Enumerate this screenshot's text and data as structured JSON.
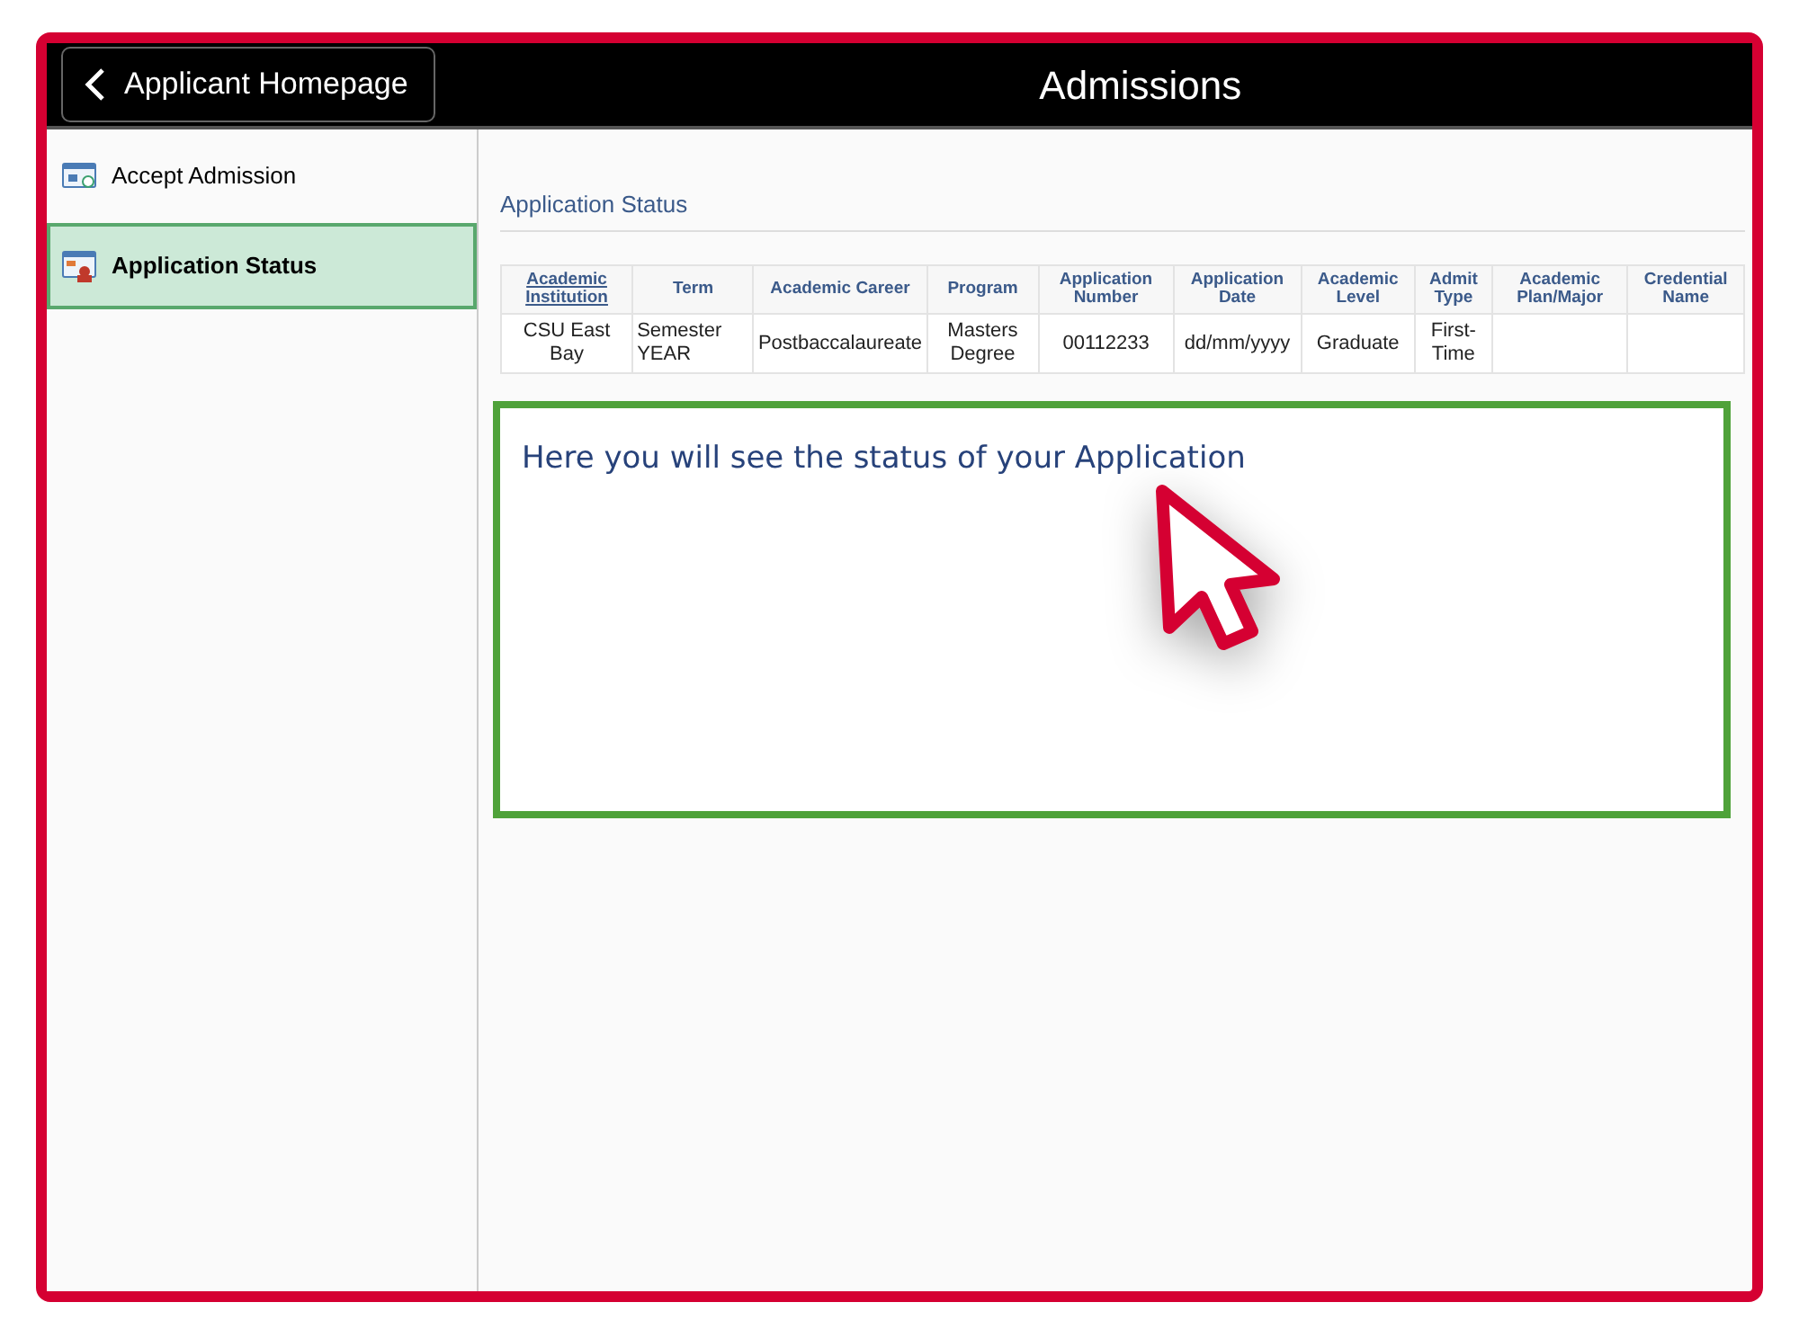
{
  "header": {
    "back_label": "Applicant Homepage",
    "title": "Admissions"
  },
  "sidebar": {
    "items": [
      {
        "label": "Accept Admission",
        "selected": false
      },
      {
        "label": "Application Status",
        "selected": true
      }
    ]
  },
  "section_title": "Application Status",
  "table": {
    "columns": [
      "Academic Institution",
      "Term",
      "Academic Career",
      "Program",
      "Application Number",
      "Application Date",
      "Academic Level",
      "Admit Type",
      "Academic Plan/Major",
      "Credential Name"
    ],
    "rows": [
      [
        "CSU East Bay",
        "Semester YEAR",
        "Postbaccalaureate",
        "Masters Degree",
        "00112233",
        "dd/mm/yyyy",
        "Graduate",
        "First-Time",
        "",
        ""
      ]
    ]
  },
  "callout": {
    "text": "Here you will see the status of your Application"
  }
}
